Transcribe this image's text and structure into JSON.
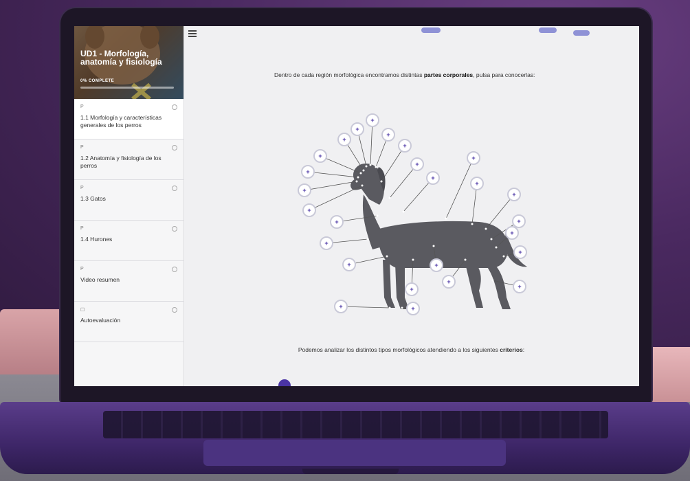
{
  "sidebar": {
    "course_title": "UD1 - Morfología, anatomía y fisiología",
    "progress_label": "0% COMPLETE",
    "progress_fraction": 0,
    "lessons": [
      {
        "type_icon": "P",
        "title": "1.1 Morfología y características generales de los perros"
      },
      {
        "type_icon": "P",
        "title": "1.2 Anatomía y fisiología de los perros"
      },
      {
        "type_icon": "P",
        "title": "1.3 Gatos"
      },
      {
        "type_icon": "P",
        "title": "1.4 Hurones"
      },
      {
        "type_icon": "P",
        "title": "Video resumen"
      },
      {
        "type_icon": "☐",
        "title": "Autoevaluación"
      }
    ]
  },
  "content": {
    "intro_pre": "Dentro de cada región morfológica encontramos distintas ",
    "intro_bold": "partes corporales",
    "intro_post": ", pulsa para conocerlas:",
    "criteria_pre": "Podemos analizar los distintos tipos morfológicos atendiendo a los siguientes ",
    "criteria_bold": "criterios",
    "criteria_post": ":",
    "hotspot_label": "+"
  },
  "colors": {
    "accent": "#4a34a5",
    "hotspot_ring": "#c9c9d8"
  }
}
